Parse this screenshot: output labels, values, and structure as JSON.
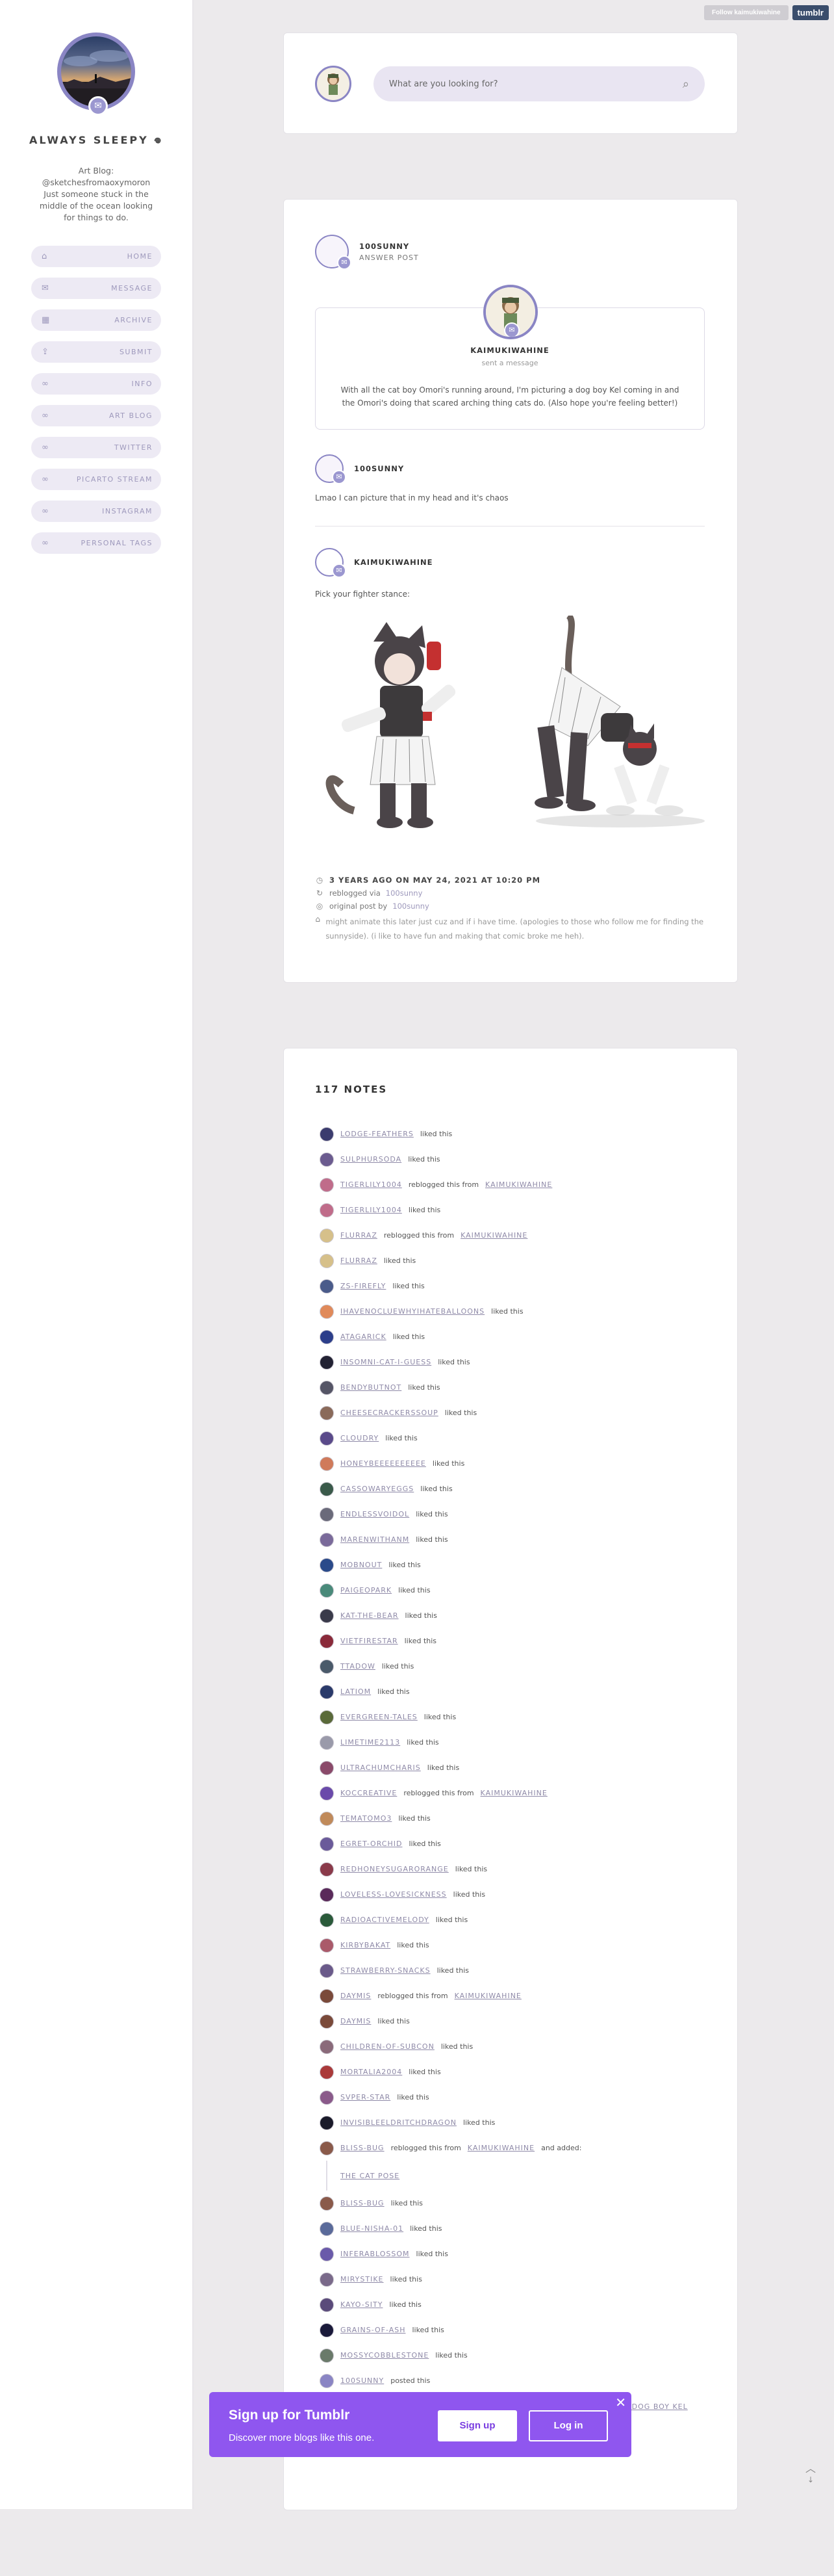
{
  "topbar": {
    "follow_label": "Follow kaimukiwahine",
    "tumblr_label": "tumblr"
  },
  "sidebar": {
    "title": "ALWAYS SLEEPY 𖦹",
    "bio": "Art Blog: @sketchesfromaoxymoron Just someone stuck in the middle of the ocean looking for things to do.",
    "items": [
      {
        "label": "HOME",
        "icon": "home-icon",
        "glyph": "⌂"
      },
      {
        "label": "MESSAGE",
        "icon": "mail-icon",
        "glyph": "✉"
      },
      {
        "label": "ARCHIVE",
        "icon": "grid-icon",
        "glyph": "▦"
      },
      {
        "label": "SUBMIT",
        "icon": "upload-icon",
        "glyph": "⇪"
      },
      {
        "label": "INFO",
        "icon": "link-icon",
        "glyph": "∞"
      },
      {
        "label": "ART BLOG",
        "icon": "link-icon",
        "glyph": "∞"
      },
      {
        "label": "TWITTER",
        "icon": "link-icon",
        "glyph": "∞"
      },
      {
        "label": "PICARTO STREAM",
        "icon": "link-icon",
        "glyph": "∞"
      },
      {
        "label": "INSTAGRAM",
        "icon": "link-icon",
        "glyph": "∞"
      },
      {
        "label": "PERSONAL TAGS",
        "icon": "link-icon",
        "glyph": "∞"
      }
    ]
  },
  "search": {
    "placeholder": "What are you looking for?",
    "icon": "search-icon"
  },
  "post": {
    "asker_name": "100SUNNY",
    "post_type": "ANSWER POST",
    "ask_name": "KAIMUKIWAHINE",
    "ask_sub": "sent a message",
    "ask_text": "With all the cat boy Omori's running around, I'm picturing a dog boy Kel coming in and the Omori's doing that scared arching thing cats do. (Also hope you're feeling better!)",
    "reply1_name": "100SUNNY",
    "reply1_text": "Lmao I can picture that in my head and it's chaos",
    "reply2_name": "KAIMUKIWAHINE",
    "reply2_text": "Pick your fighter stance:",
    "date": "3 YEARS AGO ON MAY 24, 2021 AT 10:20 PM",
    "reblogged_prefix": "reblogged via",
    "reblogged_from": "100sunny",
    "original_prefix": "original post by",
    "original_by": "100sunny",
    "tags": "might animate this later just cuz and if i have time. (apologies to those who follow me for finding the sunnyside). (i like to have fun and making that comic broke me heh)."
  },
  "notes": {
    "title": "117 NOTES",
    "items": [
      {
        "user": "LODGE-FEATHERS",
        "action": "liked this",
        "color": "#3b3c6e"
      },
      {
        "user": "SULPHURSODA",
        "action": "liked this",
        "color": "#6b5b8f"
      },
      {
        "user": "TIGERLILY1004",
        "action": "reblogged this from",
        "from": "KAIMUKIWAHINE",
        "color": "#c06c8a"
      },
      {
        "user": "TIGERLILY1004",
        "action": "liked this",
        "color": "#c06c8a"
      },
      {
        "user": "FLURRAZ",
        "action": "reblogged this from",
        "from": "KAIMUKIWAHINE",
        "color": "#d6c08a"
      },
      {
        "user": "FLURRAZ",
        "action": "liked this",
        "color": "#d6c08a"
      },
      {
        "user": "ZS-FIREFLY",
        "action": "liked this",
        "color": "#4a5b8a"
      },
      {
        "user": "IHAVENOCLUEWHYIHATEBALLOONS",
        "action": "liked this",
        "color": "#e08a5a"
      },
      {
        "user": "ATAGARICK",
        "action": "liked this",
        "color": "#2c3e8a"
      },
      {
        "user": "INSOMNI-CAT-I-GUESS",
        "action": "liked this",
        "color": "#222233"
      },
      {
        "user": "BENDYBUTNOT",
        "action": "liked this",
        "color": "#555566"
      },
      {
        "user": "CHEESECRACKERSSOUP",
        "action": "liked this",
        "color": "#8a6a5a"
      },
      {
        "user": "CLOUDRY",
        "action": "liked this",
        "color": "#5a4a8a"
      },
      {
        "user": "HONEYBEEEEEEEEEE",
        "action": "liked this",
        "color": "#d07a5a"
      },
      {
        "user": "CASSOWARYEGGS",
        "action": "liked this",
        "color": "#3a5a4a"
      },
      {
        "user": "ENDLESSVOIDOL",
        "action": "liked this",
        "color": "#6a6a7a"
      },
      {
        "user": "MARENWITHANM",
        "action": "liked this",
        "color": "#7a6a9a"
      },
      {
        "user": "MOBNOUT",
        "action": "liked this",
        "color": "#2a4a8a"
      },
      {
        "user": "PAIGEOPARK",
        "action": "liked this",
        "color": "#4a8a7a"
      },
      {
        "user": "KAT-THE-BEAR",
        "action": "liked this",
        "color": "#3a3a4a"
      },
      {
        "user": "VIETFIRESTAR",
        "action": "liked this",
        "color": "#8a2a3a"
      },
      {
        "user": "TTADOW",
        "action": "liked this",
        "color": "#4a5a6a"
      },
      {
        "user": "LATIOM",
        "action": "liked this",
        "color": "#2a3a6a"
      },
      {
        "user": "EVERGREEN-TALES",
        "action": "liked this",
        "color": "#5a6a3a"
      },
      {
        "user": "LIMETIME2113",
        "action": "liked this",
        "color": "#9a9aaa"
      },
      {
        "user": "ULTRACHUMCHARIS",
        "action": "liked this",
        "color": "#8a4a6a"
      },
      {
        "user": "KOCCREATIVE",
        "action": "reblogged this from",
        "from": "KAIMUKIWAHINE",
        "color": "#6a4aaa"
      },
      {
        "user": "TEMATOMO3",
        "action": "liked this",
        "color": "#c08a5a"
      },
      {
        "user": "EGRET-ORCHID",
        "action": "liked this",
        "color": "#6a5a9a"
      },
      {
        "user": "REDHONEYSUGARORANGE",
        "action": "liked this",
        "color": "#8a3a4a"
      },
      {
        "user": "LOVELESS-LOVESICKNESS",
        "action": "liked this",
        "color": "#5a2a5a"
      },
      {
        "user": "RADIOACTIVEMELODY",
        "action": "liked this",
        "color": "#2a5a3a"
      },
      {
        "user": "KIRBYBAKAT",
        "action": "liked this",
        "color": "#aa5a6a"
      },
      {
        "user": "STRAWBERRY-SNACKS",
        "action": "liked this",
        "color": "#6a5a8a"
      },
      {
        "user": "DAYMIS",
        "action": "reblogged this from",
        "from": "KAIMUKIWAHINE",
        "color": "#7a4a3a"
      },
      {
        "user": "DAYMIS",
        "action": "liked this",
        "color": "#7a4a3a"
      },
      {
        "user": "CHILDREN-OF-SUBCON",
        "action": "liked this",
        "color": "#8a6a7a"
      },
      {
        "user": "MORTALIA2004",
        "action": "liked this",
        "color": "#aa3a3a"
      },
      {
        "user": "SVPER-STAR",
        "action": "liked this",
        "color": "#8a5a8a"
      },
      {
        "user": "INVISIBLEELDRITCHDRAGON",
        "action": "liked this",
        "color": "#1a1a2a"
      },
      {
        "user": "BLISS-BUG",
        "action": "reblogged this from",
        "from": "KAIMUKIWAHINE",
        "suffix": "and added:",
        "color": "#8a5a4a"
      },
      {
        "type": "quote",
        "user": "THE CAT POSE"
      },
      {
        "user": "BLISS-BUG",
        "action": "liked this",
        "color": "#8a5a4a"
      },
      {
        "user": "BLUE-NISHA-01",
        "action": "liked this",
        "color": "#5a6a9a"
      },
      {
        "user": "INFERABLOSSOM",
        "action": "liked this",
        "color": "#6a5aaa"
      },
      {
        "user": "MIRYSTIKE",
        "action": "liked this",
        "color": "#7a6a8a"
      },
      {
        "user": "KAYO-SITY",
        "action": "liked this",
        "color": "#5a4a7a"
      },
      {
        "user": "GRAINS-OF-ASH",
        "action": "liked this",
        "color": "#1a1a3a"
      },
      {
        "user": "MOSSYCOBBLESTONE",
        "action": "liked this",
        "color": "#6a7a6a"
      },
      {
        "user": "100SUNNY",
        "action": "posted this",
        "color": "#8a85c4"
      },
      {
        "type": "long",
        "user": "WITH ALL THE CAT BOY OMORI'S RUNNING AROUND, I'M PICTURING A DOG BOY KEL COMING IN AND THE OMORI'S DOING THAT SCARED..."
      }
    ]
  },
  "signup": {
    "heading": "Sign up for Tumblr",
    "desc": "Discover more blogs like this one.",
    "signup_label": "Sign up",
    "login_label": "Log in",
    "close_glyph": "✕"
  },
  "totop": {
    "glyph": "︿",
    "label": "↓"
  }
}
